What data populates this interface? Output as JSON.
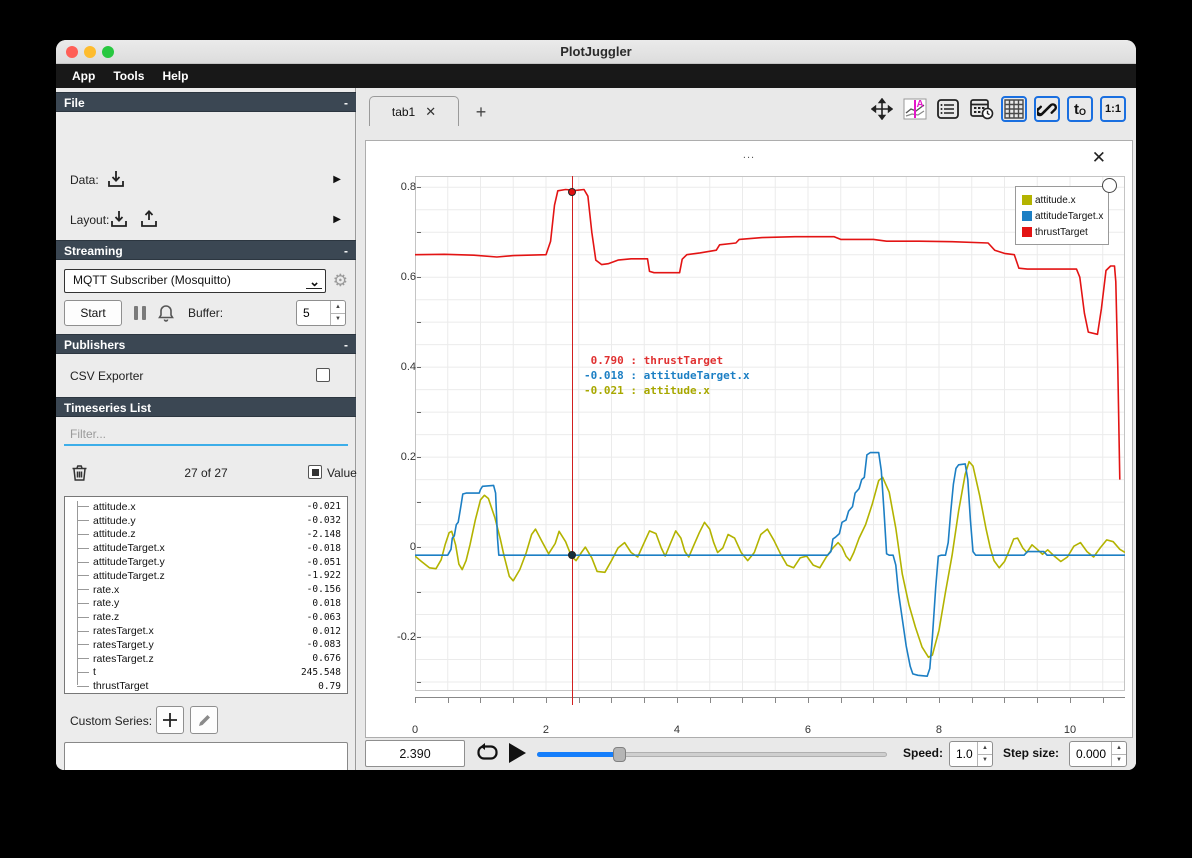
{
  "window": {
    "title": "PlotJuggler"
  },
  "menu": {
    "items": [
      "App",
      "Tools",
      "Help"
    ]
  },
  "ui": {
    "collapse_glyph": "-",
    "menu_arrow": "▶",
    "close_glyph": "✕",
    "plus_glyph": "+",
    "spin_up": "▲",
    "spin_down": "▼",
    "ellipsis": "...",
    "gear_glyph": "⚙"
  },
  "sidebar": {
    "file": {
      "header": "File",
      "data_label": "Data:",
      "layout_label": "Layout:"
    },
    "streaming": {
      "header": "Streaming",
      "source": "MQTT Subscriber (Mosquitto)",
      "start_label": "Start",
      "buffer_label": "Buffer:",
      "buffer_value": "5"
    },
    "publishers": {
      "header": "Publishers",
      "csv_exporter_label": "CSV Exporter"
    },
    "timeseries": {
      "header": "Timeseries List",
      "filter_placeholder": "Filter...",
      "count_label": "27 of 27",
      "values_label": "Values",
      "items": [
        {
          "name": "attitude.x",
          "value": "-0.021"
        },
        {
          "name": "attitude.y",
          "value": "-0.032"
        },
        {
          "name": "attitude.z",
          "value": "-2.148"
        },
        {
          "name": "attitudeTarget.x",
          "value": "-0.018"
        },
        {
          "name": "attitudeTarget.y",
          "value": "-0.051"
        },
        {
          "name": "attitudeTarget.z",
          "value": "-1.922"
        },
        {
          "name": "rate.x",
          "value": "-0.156"
        },
        {
          "name": "rate.y",
          "value": "0.018"
        },
        {
          "name": "rate.z",
          "value": "-0.063"
        },
        {
          "name": "ratesTarget.x",
          "value": "0.012"
        },
        {
          "name": "ratesTarget.y",
          "value": "-0.083"
        },
        {
          "name": "ratesTarget.z",
          "value": "0.676"
        },
        {
          "name": "t",
          "value": "245.548"
        },
        {
          "name": "thrustTarget",
          "value": "0.79"
        }
      ]
    },
    "custom_series": {
      "label": "Custom Series:"
    }
  },
  "main": {
    "tab": {
      "label": "tab1"
    },
    "toolbar": {
      "t0_main": "t",
      "t0_sub": "O",
      "ratio_label": "1:1"
    },
    "transport": {
      "time": "2.390",
      "speed_label": "Speed:",
      "speed_value": "1.0",
      "step_label": "Step size:",
      "step_value": "0.000",
      "slider_fraction": 0.235
    }
  },
  "chart_data": {
    "type": "line",
    "title": "",
    "xlabel": "",
    "ylabel": "",
    "xlim": [
      0,
      10.84
    ],
    "ylim": [
      -0.32,
      0.825
    ],
    "x_ticks": [
      0,
      2,
      4,
      6,
      8,
      10
    ],
    "y_ticks": [
      0.8,
      0.6,
      0.4,
      0.2,
      0,
      -0.2
    ],
    "grid": true,
    "legend_position": "top-right",
    "tracker": {
      "x": 2.39,
      "readout": [
        {
          "value": "0.790",
          "name": "thrustTarget",
          "color": "#e03131"
        },
        {
          "value": "-0.018",
          "name": "attitudeTarget.x",
          "color": "#1c7fc4"
        },
        {
          "value": "-0.021",
          "name": "attitude.x",
          "color": "#a8a800"
        }
      ],
      "dots": [
        {
          "y": 0.79,
          "color": "#e01010"
        },
        {
          "y": -0.018,
          "color": "#16303c"
        }
      ]
    },
    "series": [
      {
        "name": "attitude.x",
        "color": "#b3b300",
        "points": [
          [
            0,
            -0.02
          ],
          [
            0.1,
            -0.032
          ],
          [
            0.22,
            -0.046
          ],
          [
            0.32,
            -0.048
          ],
          [
            0.4,
            -0.028
          ],
          [
            0.46,
            0.005
          ],
          [
            0.52,
            0.032
          ],
          [
            0.56,
            0.035
          ],
          [
            0.62,
            0.005
          ],
          [
            0.67,
            -0.038
          ],
          [
            0.72,
            -0.05
          ],
          [
            0.78,
            -0.03
          ],
          [
            0.84,
            0.005
          ],
          [
            0.92,
            0.06
          ],
          [
            1.0,
            0.105
          ],
          [
            1.06,
            0.115
          ],
          [
            1.12,
            0.108
          ],
          [
            1.22,
            0.065
          ],
          [
            1.3,
            0.02
          ],
          [
            1.36,
            -0.02
          ],
          [
            1.44,
            -0.065
          ],
          [
            1.5,
            -0.075
          ],
          [
            1.6,
            -0.05
          ],
          [
            1.7,
            -0.012
          ],
          [
            1.78,
            0.028
          ],
          [
            1.84,
            0.04
          ],
          [
            1.94,
            0.012
          ],
          [
            2.04,
            -0.015
          ],
          [
            2.14,
            0.008
          ],
          [
            2.2,
            0.035
          ],
          [
            2.3,
            0.012
          ],
          [
            2.39,
            -0.021
          ],
          [
            2.46,
            -0.03
          ],
          [
            2.54,
            -0.012
          ],
          [
            2.6,
            0.0
          ],
          [
            2.7,
            -0.024
          ],
          [
            2.78,
            -0.054
          ],
          [
            2.9,
            -0.056
          ],
          [
            3.0,
            -0.03
          ],
          [
            3.1,
            -0.002
          ],
          [
            3.2,
            0.01
          ],
          [
            3.3,
            -0.012
          ],
          [
            3.4,
            -0.022
          ],
          [
            3.5,
            0.01
          ],
          [
            3.58,
            0.036
          ],
          [
            3.68,
            0.03
          ],
          [
            3.76,
            -0.002
          ],
          [
            3.82,
            -0.02
          ],
          [
            3.9,
            0.008
          ],
          [
            3.98,
            0.036
          ],
          [
            4.06,
            0.02
          ],
          [
            4.12,
            -0.01
          ],
          [
            4.18,
            -0.022
          ],
          [
            4.26,
            0.005
          ],
          [
            4.34,
            0.032
          ],
          [
            4.42,
            0.055
          ],
          [
            4.5,
            0.04
          ],
          [
            4.56,
            0.01
          ],
          [
            4.62,
            -0.012
          ],
          [
            4.7,
            -0.002
          ],
          [
            4.78,
            0.028
          ],
          [
            4.88,
            0.02
          ],
          [
            4.98,
            -0.012
          ],
          [
            5.08,
            -0.03
          ],
          [
            5.18,
            -0.012
          ],
          [
            5.28,
            0.028
          ],
          [
            5.38,
            0.04
          ],
          [
            5.48,
            0.015
          ],
          [
            5.58,
            -0.015
          ],
          [
            5.68,
            -0.04
          ],
          [
            5.78,
            -0.046
          ],
          [
            5.88,
            -0.024
          ],
          [
            5.98,
            -0.02
          ],
          [
            6.08,
            -0.04
          ],
          [
            6.18,
            -0.046
          ],
          [
            6.28,
            -0.022
          ],
          [
            6.38,
            -0.002
          ],
          [
            6.46,
            0.01
          ],
          [
            6.52,
            0.0
          ],
          [
            6.58,
            -0.02
          ],
          [
            6.64,
            -0.03
          ],
          [
            6.7,
            -0.012
          ],
          [
            6.78,
            0.02
          ],
          [
            6.88,
            0.05
          ],
          [
            6.98,
            0.095
          ],
          [
            7.08,
            0.148
          ],
          [
            7.14,
            0.155
          ],
          [
            7.24,
            0.122
          ],
          [
            7.34,
            0.042
          ],
          [
            7.44,
            -0.06
          ],
          [
            7.54,
            -0.128
          ],
          [
            7.64,
            -0.178
          ],
          [
            7.74,
            -0.222
          ],
          [
            7.84,
            -0.245
          ],
          [
            7.9,
            -0.24
          ],
          [
            8.0,
            -0.185
          ],
          [
            8.1,
            -0.1
          ],
          [
            8.2,
            -0.018
          ],
          [
            8.3,
            0.08
          ],
          [
            8.4,
            0.162
          ],
          [
            8.46,
            0.19
          ],
          [
            8.52,
            0.18
          ],
          [
            8.62,
            0.115
          ],
          [
            8.72,
            0.04
          ],
          [
            8.78,
            0.0
          ],
          [
            8.84,
            -0.03
          ],
          [
            8.92,
            -0.046
          ],
          [
            9.0,
            -0.032
          ],
          [
            9.06,
            -0.012
          ],
          [
            9.14,
            0.018
          ],
          [
            9.2,
            0.02
          ],
          [
            9.28,
            -0.002
          ],
          [
            9.34,
            -0.012
          ],
          [
            9.42,
            0.005
          ],
          [
            9.5,
            -0.005
          ],
          [
            9.58,
            -0.016
          ],
          [
            9.66,
            -0.006
          ],
          [
            9.76,
            -0.02
          ],
          [
            9.86,
            -0.032
          ],
          [
            9.96,
            -0.022
          ],
          [
            10.06,
            0.002
          ],
          [
            10.16,
            0.01
          ],
          [
            10.26,
            -0.01
          ],
          [
            10.36,
            -0.022
          ],
          [
            10.46,
            -0.002
          ],
          [
            10.56,
            0.016
          ],
          [
            10.66,
            0.012
          ],
          [
            10.76,
            -0.005
          ],
          [
            10.84,
            -0.012
          ]
        ]
      },
      {
        "name": "attitudeTarget.x",
        "color": "#1c7fc4",
        "points": [
          [
            0,
            -0.018
          ],
          [
            0.5,
            -0.018
          ],
          [
            0.55,
            -0.005
          ],
          [
            0.57,
            0.02
          ],
          [
            0.6,
            0.025
          ],
          [
            0.63,
            0.05
          ],
          [
            0.66,
            0.055
          ],
          [
            0.7,
            0.09
          ],
          [
            0.73,
            0.118
          ],
          [
            0.78,
            0.12
          ],
          [
            0.98,
            0.12
          ],
          [
            1.0,
            0.128
          ],
          [
            1.03,
            0.135
          ],
          [
            1.2,
            0.137
          ],
          [
            1.23,
            0.12
          ],
          [
            1.26,
            0.02
          ],
          [
            1.28,
            -0.018
          ],
          [
            6.3,
            -0.018
          ],
          [
            6.35,
            -0.01
          ],
          [
            6.38,
            0.018
          ],
          [
            6.42,
            0.022
          ],
          [
            6.48,
            0.03
          ],
          [
            6.52,
            0.055
          ],
          [
            6.58,
            0.06
          ],
          [
            6.62,
            0.08
          ],
          [
            6.68,
            0.09
          ],
          [
            6.72,
            0.12
          ],
          [
            6.78,
            0.13
          ],
          [
            6.82,
            0.15
          ],
          [
            6.86,
            0.155
          ],
          [
            6.9,
            0.205
          ],
          [
            6.95,
            0.21
          ],
          [
            7.08,
            0.21
          ],
          [
            7.12,
            0.17
          ],
          [
            7.16,
            0.08
          ],
          [
            7.2,
            -0.015
          ],
          [
            7.24,
            -0.018
          ],
          [
            7.3,
            -0.018
          ],
          [
            7.34,
            -0.04
          ],
          [
            7.38,
            -0.1
          ],
          [
            7.44,
            -0.16
          ],
          [
            7.5,
            -0.22
          ],
          [
            7.56,
            -0.265
          ],
          [
            7.6,
            -0.282
          ],
          [
            7.68,
            -0.285
          ],
          [
            7.82,
            -0.287
          ],
          [
            7.86,
            -0.27
          ],
          [
            7.9,
            -0.2
          ],
          [
            7.95,
            -0.09
          ],
          [
            7.99,
            -0.02
          ],
          [
            8.03,
            -0.018
          ],
          [
            8.1,
            -0.018
          ],
          [
            8.14,
            0.01
          ],
          [
            8.18,
            0.08
          ],
          [
            8.22,
            0.14
          ],
          [
            8.26,
            0.175
          ],
          [
            8.3,
            0.183
          ],
          [
            8.4,
            0.185
          ],
          [
            8.44,
            0.15
          ],
          [
            8.48,
            0.06
          ],
          [
            8.52,
            -0.01
          ],
          [
            8.56,
            -0.018
          ],
          [
            9.3,
            -0.018
          ],
          [
            9.35,
            -0.01
          ],
          [
            9.6,
            -0.01
          ],
          [
            9.65,
            -0.018
          ],
          [
            10.84,
            -0.018
          ]
        ]
      },
      {
        "name": "thrustTarget",
        "color": "#e31414",
        "points": [
          [
            0,
            0.65
          ],
          [
            0.45,
            0.651
          ],
          [
            0.9,
            0.649
          ],
          [
            1.25,
            0.645
          ],
          [
            1.5,
            0.648
          ],
          [
            2.0,
            0.65
          ],
          [
            2.07,
            0.68
          ],
          [
            2.13,
            0.76
          ],
          [
            2.18,
            0.792
          ],
          [
            2.3,
            0.795
          ],
          [
            2.45,
            0.793
          ],
          [
            2.58,
            0.795
          ],
          [
            2.64,
            0.78
          ],
          [
            2.7,
            0.7
          ],
          [
            2.76,
            0.638
          ],
          [
            2.85,
            0.628
          ],
          [
            2.95,
            0.63
          ],
          [
            3.1,
            0.638
          ],
          [
            3.3,
            0.641
          ],
          [
            3.55,
            0.641
          ],
          [
            3.58,
            0.613
          ],
          [
            3.65,
            0.61
          ],
          [
            4.0,
            0.61
          ],
          [
            4.04,
            0.61
          ],
          [
            4.08,
            0.64
          ],
          [
            4.15,
            0.65
          ],
          [
            4.35,
            0.654
          ],
          [
            4.6,
            0.66
          ],
          [
            4.65,
            0.672
          ],
          [
            4.9,
            0.676
          ],
          [
            4.95,
            0.684
          ],
          [
            5.3,
            0.688
          ],
          [
            5.8,
            0.69
          ],
          [
            6.4,
            0.69
          ],
          [
            6.5,
            0.684
          ],
          [
            7.0,
            0.684
          ],
          [
            7.2,
            0.68
          ],
          [
            7.7,
            0.68
          ],
          [
            8.2,
            0.679
          ],
          [
            8.75,
            0.676
          ],
          [
            8.85,
            0.66
          ],
          [
            9.0,
            0.653
          ],
          [
            9.15,
            0.65
          ],
          [
            9.22,
            0.62
          ],
          [
            9.35,
            0.618
          ],
          [
            10.1,
            0.618
          ],
          [
            10.15,
            0.6
          ],
          [
            10.22,
            0.52
          ],
          [
            10.28,
            0.478
          ],
          [
            10.42,
            0.473
          ],
          [
            10.48,
            0.53
          ],
          [
            10.55,
            0.615
          ],
          [
            10.62,
            0.625
          ],
          [
            10.68,
            0.625
          ],
          [
            10.7,
            0.59
          ],
          [
            10.73,
            0.4
          ],
          [
            10.76,
            0.15
          ]
        ]
      }
    ]
  }
}
